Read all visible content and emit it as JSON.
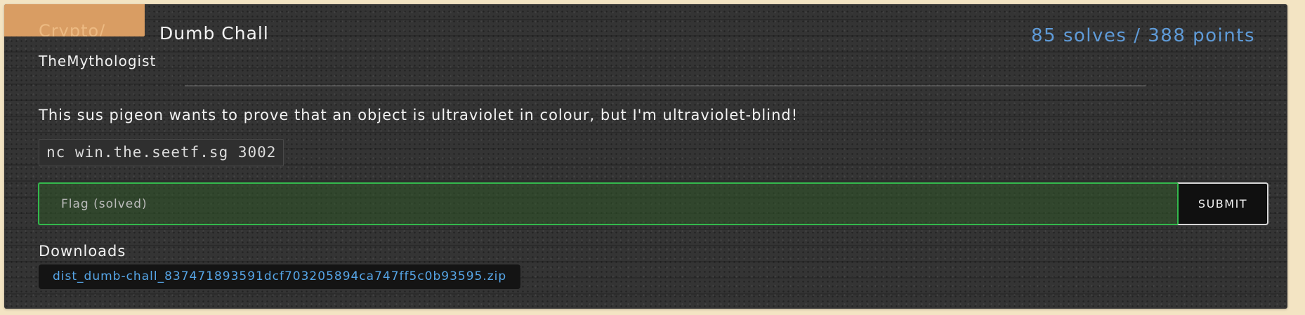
{
  "challenge": {
    "category": "Crypto/",
    "title": "Dumb Chall",
    "score": "85 solves / 388 points",
    "author": "TheMythologist",
    "description": "This sus pigeon wants to prove that an object is ultraviolet in colour, but I'm ultraviolet-blind!",
    "connection": "nc win.the.seetf.sg 3002"
  },
  "flag_form": {
    "placeholder": "Flag (solved)",
    "submit_label": "SUBMIT"
  },
  "downloads": {
    "heading": "Downloads",
    "files": [
      {
        "name": "dist_dumb-chall_837471893591dcf703205894ca747ff5c0b93595.zip"
      }
    ]
  },
  "colors": {
    "card_background": "#343434",
    "category_badge": "#d99d63",
    "score_text": "#5f9bd8",
    "solved_border": "#33b84c",
    "link_text": "#56a6e8"
  }
}
